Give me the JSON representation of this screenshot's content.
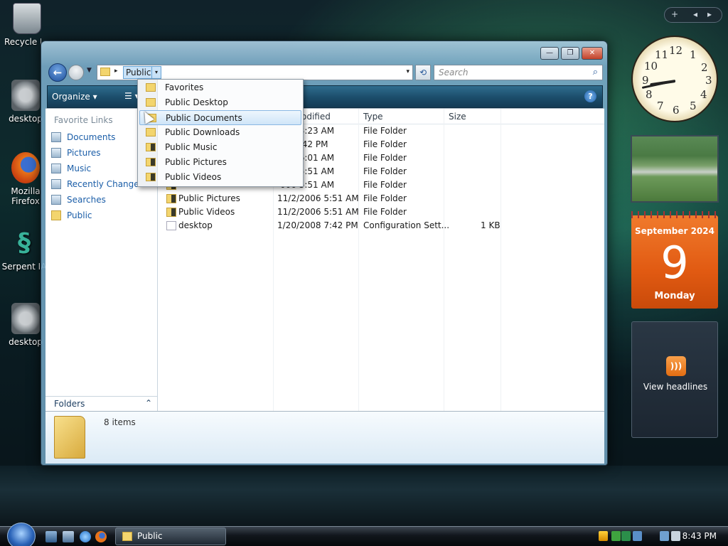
{
  "desktop": {
    "icons": [
      {
        "label": "Recycle Bin"
      },
      {
        "label": "desktop"
      },
      {
        "label": "Mozilla Firefox"
      },
      {
        "label": "Serpent IA"
      },
      {
        "label": "desktop"
      }
    ]
  },
  "window": {
    "controls": {
      "minimize": "—",
      "maximize": "❐",
      "close": "✕"
    },
    "address": {
      "crumb": "Public",
      "separator": "▸",
      "dropdown": "▾",
      "history": "▾"
    },
    "search": {
      "placeholder": "Search",
      "icon": "magnifier-icon"
    },
    "toolbar": {
      "organize": "Organize ▾",
      "views": "☰ ▾",
      "help": "?"
    },
    "nav_pane": {
      "heading": "Favorite Links",
      "items": [
        {
          "label": "Documents",
          "icon": "documents-icon"
        },
        {
          "label": "Pictures",
          "icon": "pictures-icon"
        },
        {
          "label": "Music",
          "icon": "music-icon"
        },
        {
          "label": "Recently Changed",
          "icon": "recently-changed-icon"
        },
        {
          "label": "Searches",
          "icon": "searches-icon"
        },
        {
          "label": "Public",
          "icon": "folder-icon"
        }
      ],
      "folders_label": "Folders",
      "folders_toggle": "⌃"
    },
    "columns": [
      {
        "label": "odified"
      },
      {
        "label": "Type"
      },
      {
        "label": "Size"
      }
    ],
    "rows": [
      {
        "name": "",
        "date": "006 3:23 AM",
        "type": "File Folder",
        "size": ""
      },
      {
        "name": "",
        "date": "24 6:42 PM",
        "type": "File Folder",
        "size": ""
      },
      {
        "name": "",
        "date": "006 6:01 AM",
        "type": "File Folder",
        "size": ""
      },
      {
        "name": "",
        "date": "006 5:51 AM",
        "type": "File Folder",
        "size": ""
      },
      {
        "name": "",
        "date": "006 5:51 AM",
        "type": "File Folder",
        "size": ""
      },
      {
        "name": "Public Pictures",
        "date": "11/2/2006 5:51 AM",
        "type": "File Folder",
        "size": ""
      },
      {
        "name": "Public Videos",
        "date": "11/2/2006 5:51 AM",
        "type": "File Folder",
        "size": ""
      },
      {
        "name": "desktop",
        "date": "1/20/2008 7:42 PM",
        "type": "Configuration Sett...",
        "size": "1 KB"
      }
    ],
    "details": {
      "count": "8 items"
    }
  },
  "dropdown": {
    "items": [
      {
        "label": "Favorites",
        "icon": "folder-icon"
      },
      {
        "label": "Public Desktop",
        "icon": "folder-icon"
      },
      {
        "label": "Public Documents",
        "icon": "folder-icon",
        "selected": true
      },
      {
        "label": "Public Downloads",
        "icon": "folder-icon"
      },
      {
        "label": "Public Music",
        "icon": "music-folder-icon"
      },
      {
        "label": "Public Pictures",
        "icon": "pictures-folder-icon"
      },
      {
        "label": "Public Videos",
        "icon": "videos-folder-icon"
      }
    ]
  },
  "sidebar": {
    "controls": {
      "add": "+",
      "prev": "◂",
      "next": "▸"
    },
    "clock": {
      "numbers": [
        "12",
        "1",
        "2",
        "3",
        "4",
        "5",
        "6",
        "7",
        "8",
        "9",
        "10",
        "11"
      ],
      "hour": 8,
      "minute": 43
    },
    "calendar": {
      "month": "September 2024",
      "day": "9",
      "weekday": "Monday"
    },
    "feed": {
      "label": "View headlines",
      "icon": "rss-icon"
    }
  },
  "taskbar": {
    "task": "Public",
    "time": "8:43 PM"
  },
  "colors": {
    "accent": "#1b5ea8",
    "toolbar": "#1b4c6a",
    "calendar": "#e15a12"
  }
}
